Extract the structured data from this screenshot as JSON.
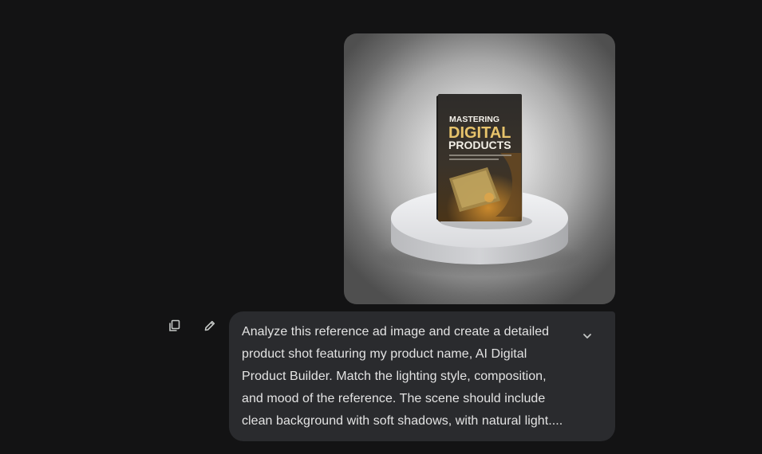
{
  "message": {
    "prompt_text": "Analyze this reference ad image and create a detailed product shot featuring my product name, AI Digital Product Builder. Match the lighting style, composition, and mood of the reference. The scene should include clean background with soft shadows, with natural light....",
    "attachment": {
      "book_title_line1": "MASTERING",
      "book_title_line2": "DIGITAL",
      "book_title_line3": "PRODUCTS"
    }
  },
  "actions": {
    "copy_icon": "copy-icon",
    "edit_icon": "pencil-icon",
    "expand_icon": "chevron-down-icon"
  },
  "colors": {
    "background": "#131314",
    "bubble": "#2a2b2e",
    "text": "#e3e3e3",
    "icon": "#c4c7c5"
  }
}
